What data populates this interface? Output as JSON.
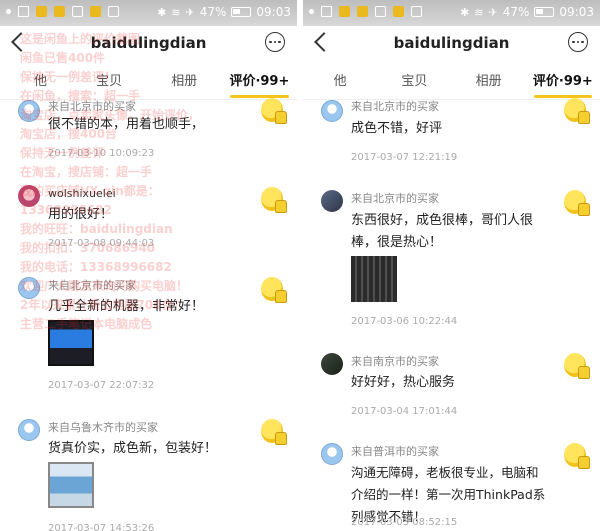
{
  "status_bar": {
    "time": "09:03",
    "battery": "47%"
  },
  "left": {
    "header": {
      "title": "baidulingdian"
    },
    "tabs": [
      "他",
      "宝贝",
      "相册",
      "评价·99+"
    ],
    "reviews": [
      {
        "reviewer": "来自北京市的买家",
        "text": "很不错的本，用着也顺手，",
        "date": "2017-03-10 10:09:23",
        "avatar": "blue"
      },
      {
        "reviewer": "wolshixuelei",
        "text": "用的很好！",
        "date": "2017-03-08 09:44:03",
        "avatar": "pink"
      },
      {
        "reviewer": "来自北京市的买家",
        "text": "几乎全新的机器，非常好！",
        "date": "2017-03-07 22:07:32",
        "avatar": "blue"
      },
      {
        "reviewer": "来自乌鲁木齐市的买家",
        "text": "货真价实，成色新，包装好！",
        "date": "2017-03-07 14:53:26",
        "avatar": "blue"
      }
    ],
    "watermark": "这是闲鱼上的评价截图\n闲鱼已售400件\n保持无一例差评！\n在闲鱼，搜索：超一手\n淘宝店，点卖家头像，开始评价，\n淘宝店，搜400台\n保持无一例差评\n在淘宝，搜店铺：超一手\n我的买店铺VX-qin都是：\n13368996682\n我的旺旺：baidulingdian\n我的扣扣：370686940\n我的电话：13368996682\n欢迎广大朋友来询问购买电脑！\n2年以来累计售出电脑700台！\n主营二手笔记本电脑成色"
  },
  "right": {
    "header": {
      "title": "baidulingdian"
    },
    "tabs": [
      "他",
      "宝贝",
      "相册",
      "评价·99+"
    ],
    "reviews": [
      {
        "reviewer": "来自北京市的买家",
        "text": "成色不错，好评",
        "date": "2017-03-07 12:21:19",
        "avatar": "blue"
      },
      {
        "reviewer": "来自北京市的买家",
        "text": "东西很好，成色很棒，哥们人很棒，很是热心！",
        "date": "2017-03-06 10:22:44",
        "avatar": "photo"
      },
      {
        "reviewer": "来自南京市的买家",
        "text": "好好好，热心服务",
        "date": "2017-03-04 17:01:44",
        "avatar": "dark"
      },
      {
        "reviewer": "来自普洱市的买家",
        "text": "沟通无障碍，老板很专业，电脑和介绍的一样！第一次用ThinkPad系列感觉不错！",
        "date": "2017-03-03 08:52:15",
        "avatar": "blue"
      }
    ]
  }
}
